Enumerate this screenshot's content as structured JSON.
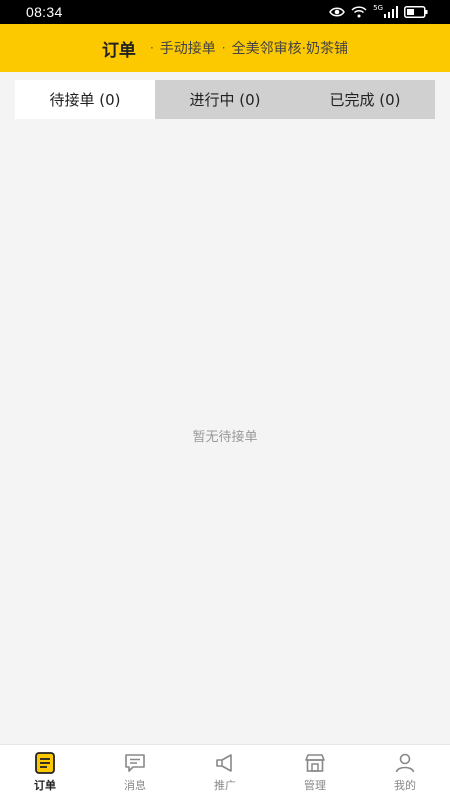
{
  "status_bar": {
    "time": "08:34",
    "network_label": "5G"
  },
  "header": {
    "title": "订单",
    "separator": "·",
    "mode": "手动接单",
    "shop": "全美邻审核·奶茶铺",
    "background_color": "#fcc800"
  },
  "tabs": [
    {
      "label": "待接单 (0)",
      "active": true
    },
    {
      "label": "进行中 (0)",
      "active": false
    },
    {
      "label": "已完成 (0)",
      "active": false
    }
  ],
  "empty_state": {
    "text": "暂无待接单"
  },
  "bottom_nav": {
    "items": [
      {
        "label": "订单",
        "icon": "order-icon",
        "active": true
      },
      {
        "label": "消息",
        "icon": "message-icon",
        "active": false
      },
      {
        "label": "推广",
        "icon": "megaphone-icon",
        "active": false
      },
      {
        "label": "管理",
        "icon": "store-icon",
        "active": false
      },
      {
        "label": "我的",
        "icon": "person-icon",
        "active": false
      }
    ]
  }
}
